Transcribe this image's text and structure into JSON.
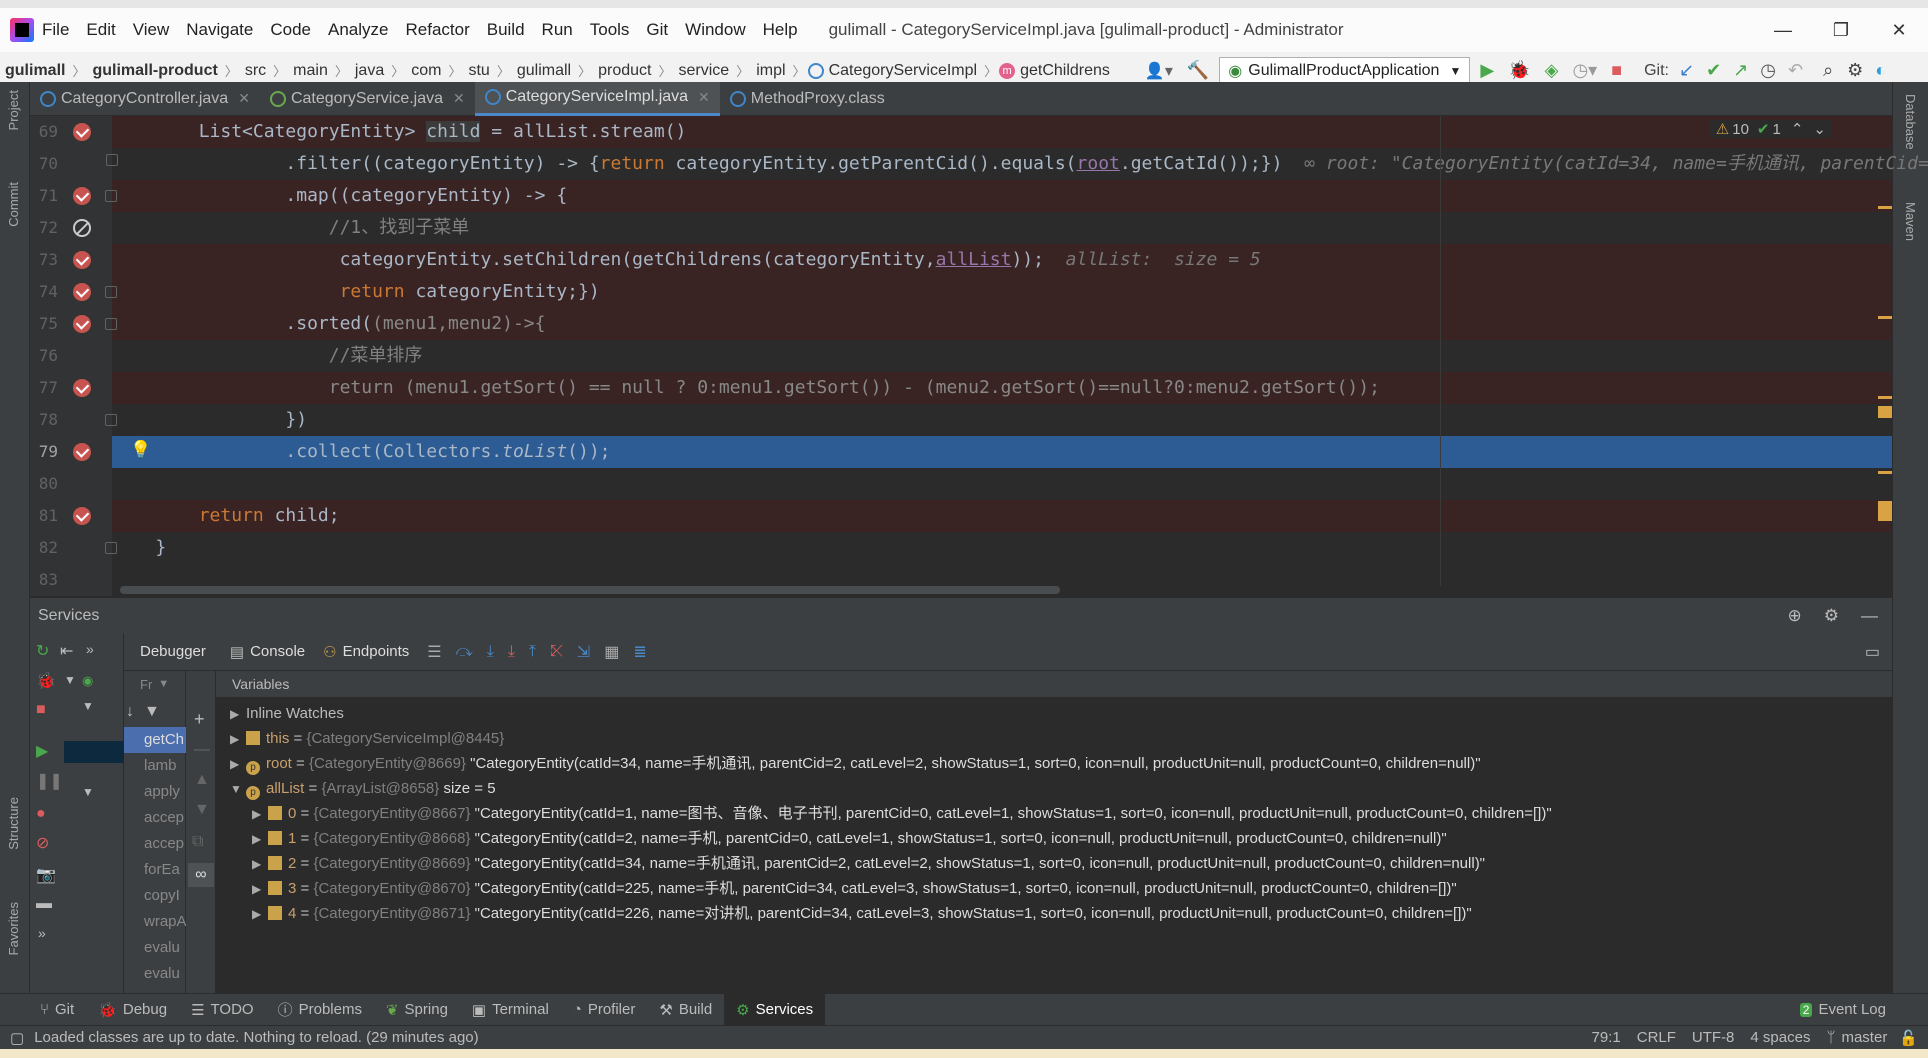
{
  "window": {
    "title": "gulimall - CategoryServiceImpl.java [gulimall-product] - Administrator",
    "menu": [
      "File",
      "Edit",
      "View",
      "Navigate",
      "Code",
      "Analyze",
      "Refactor",
      "Build",
      "Run",
      "Tools",
      "Git",
      "Window",
      "Help"
    ]
  },
  "breadcrumb": [
    "gulimall",
    "gulimall-product",
    "src",
    "main",
    "java",
    "com",
    "stu",
    "gulimall",
    "product",
    "service",
    "impl",
    "CategoryServiceImpl",
    "getChildrens"
  ],
  "run_config": "GulimallProductApplication",
  "git_label": "Git:",
  "tabs": [
    {
      "label": "CategoryController.java"
    },
    {
      "label": "CategoryService.java"
    },
    {
      "label": "CategoryServiceImpl.java"
    },
    {
      "label": "MethodProxy.class"
    }
  ],
  "sidebar_left": [
    "Project",
    "Commit",
    "Structure",
    "Favorites"
  ],
  "sidebar_right": [
    "Database",
    "Maven"
  ],
  "inspections": {
    "warnings": "10",
    "ok": "1"
  },
  "editor": {
    "lines": [
      {
        "n": "69",
        "code": "        List<CategoryEntity> child = allList.stream()"
      },
      {
        "n": "70",
        "code": "                .filter((categoryEntity) -> {return categoryEntity.getParentCid().equals(root.getCatId());})",
        "hint": "root: \"CategoryEntity(catId=34, name=手机通讯, parentCid="
      },
      {
        "n": "71",
        "code": "                .map((categoryEntity) -> {"
      },
      {
        "n": "72",
        "code": "                    //1、找到子菜单"
      },
      {
        "n": "73",
        "code": "                     categoryEntity.setChildren(getChildrens(categoryEntity,allList));",
        "hint": "allList:  size = 5"
      },
      {
        "n": "74",
        "code": "                     return categoryEntity;})"
      },
      {
        "n": "75",
        "code": "                .sorted((menu1,menu2)->{"
      },
      {
        "n": "76",
        "code": "                    //菜单排序"
      },
      {
        "n": "77",
        "code": "                    return (menu1.getSort() == null ? 0:menu1.getSort()) - (menu2.getSort()==null?0:menu2.getSort());"
      },
      {
        "n": "78",
        "code": "                })"
      },
      {
        "n": "79",
        "code": "                .collect(Collectors.toList());"
      },
      {
        "n": "80",
        "code": ""
      },
      {
        "n": "81",
        "code": "        return child;"
      },
      {
        "n": "82",
        "code": "    }"
      },
      {
        "n": "83",
        "code": ""
      }
    ]
  },
  "services": {
    "title": "Services",
    "tabs": [
      "Debugger",
      "Console",
      "Endpoints"
    ],
    "frames_label": "Fr",
    "variables_label": "Variables",
    "frames": [
      "getCh",
      "lamb",
      "apply",
      "accep",
      "accep",
      "forEa",
      "copyI",
      "wrapA",
      "evalu",
      "evalu"
    ],
    "vars": {
      "watches": "Inline Watches",
      "this_name": "this",
      "this_type": "{CategoryServiceImpl@8445}",
      "root_name": "root",
      "root_type": "{CategoryEntity@8669}",
      "root_val": "\"CategoryEntity(catId=34, name=手机通讯, parentCid=2, catLevel=2, showStatus=1, sort=0, icon=null, productUnit=null, productCount=0, children=null)\"",
      "all_name": "allList",
      "all_type": "{ArrayList@8658}",
      "all_size": "size = 5",
      "items": [
        {
          "idx": "0",
          "type": "{CategoryEntity@8667}",
          "val": "\"CategoryEntity(catId=1, name=图书、音像、电子书刊, parentCid=0, catLevel=1, showStatus=1, sort=0, icon=null, productUnit=null, productCount=0, children=[])\""
        },
        {
          "idx": "1",
          "type": "{CategoryEntity@8668}",
          "val": "\"CategoryEntity(catId=2, name=手机, parentCid=0, catLevel=1, showStatus=1, sort=0, icon=null, productUnit=null, productCount=0, children=null)\""
        },
        {
          "idx": "2",
          "type": "{CategoryEntity@8669}",
          "val": "\"CategoryEntity(catId=34, name=手机通讯, parentCid=2, catLevel=2, showStatus=1, sort=0, icon=null, productUnit=null, productCount=0, children=null)\""
        },
        {
          "idx": "3",
          "type": "{CategoryEntity@8670}",
          "val": "\"CategoryEntity(catId=225, name=手机, parentCid=34, catLevel=3, showStatus=1, sort=0, icon=null, productUnit=null, productCount=0, children=[])\""
        },
        {
          "idx": "4",
          "type": "{CategoryEntity@8671}",
          "val": "\"CategoryEntity(catId=226, name=对讲机, parentCid=34, catLevel=3, showStatus=1, sort=0, icon=null, productUnit=null, productCount=0, children=[])\""
        }
      ]
    }
  },
  "bottom_tabs": [
    "Git",
    "Debug",
    "TODO",
    "Problems",
    "Spring",
    "Terminal",
    "Profiler",
    "Build",
    "Services"
  ],
  "event_log": "Event Log",
  "event_count": "2",
  "status": {
    "message": "Loaded classes are up to date. Nothing to reload. (29 minutes ago)",
    "position": "79:1",
    "line_sep": "CRLF",
    "encoding": "UTF-8",
    "indent": "4 spaces",
    "branch": "master"
  }
}
